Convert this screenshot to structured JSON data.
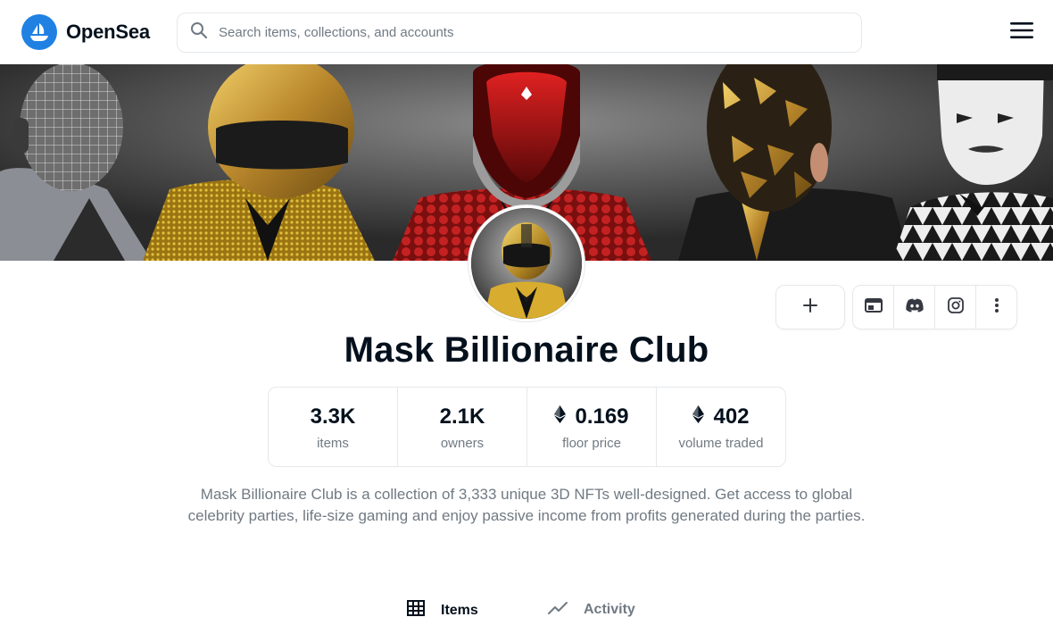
{
  "header": {
    "logo_text": "OpenSea",
    "search_placeholder": "Search items, collections, and accounts",
    "brand_color": "#2081e2"
  },
  "collection": {
    "name": "Mask Billionaire Club",
    "description": "Mask Billionaire Club is a collection of 3,333 unique 3D NFTs well-designed. Get access to global celebrity parties, life-size gaming and enjoy passive income from profits generated during the parties."
  },
  "actions": {
    "add_icon": "plus-icon",
    "links": [
      {
        "icon": "website-icon"
      },
      {
        "icon": "discord-icon"
      },
      {
        "icon": "instagram-icon"
      },
      {
        "icon": "more-vertical-icon"
      }
    ]
  },
  "stats": [
    {
      "value": "3.3K",
      "label": "items",
      "eth": false
    },
    {
      "value": "2.1K",
      "label": "owners",
      "eth": false
    },
    {
      "value": "0.169",
      "label": "floor price",
      "eth": true
    },
    {
      "value": "402",
      "label": "volume traded",
      "eth": true
    }
  ],
  "tabs": [
    {
      "label": "Items",
      "icon": "grid-icon",
      "active": true
    },
    {
      "label": "Activity",
      "icon": "activity-chart-icon",
      "active": false
    }
  ]
}
